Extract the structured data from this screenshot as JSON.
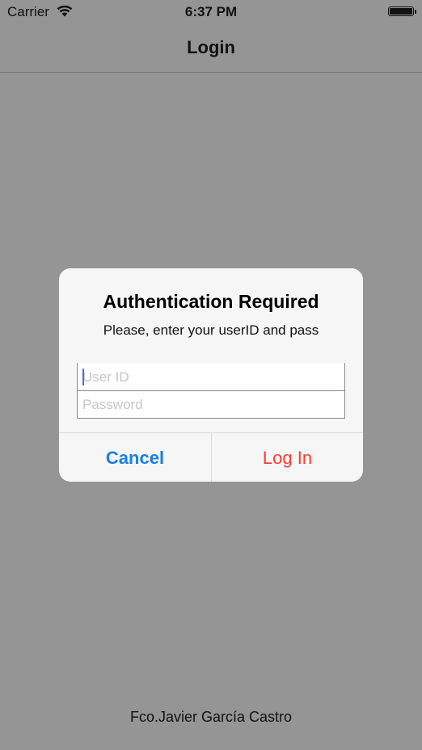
{
  "status_bar": {
    "carrier": "Carrier",
    "time": "6:37 PM",
    "wifi_icon": "wifi-icon",
    "battery_icon": "battery-icon",
    "battery_level": 1.0
  },
  "nav": {
    "title": "Login"
  },
  "alert": {
    "title": "Authentication Required",
    "message": "Please, enter your userID and pass",
    "user_id_placeholder": "User ID",
    "user_id_value": "",
    "password_placeholder": "Password",
    "password_value": "",
    "cancel_label": "Cancel",
    "login_label": "Log In"
  },
  "footer": {
    "author": "Fco.Javier García Castro"
  },
  "colors": {
    "cancel": "#1a7ee6",
    "login": "#ff3b30",
    "dimmed_background": "#959595"
  }
}
